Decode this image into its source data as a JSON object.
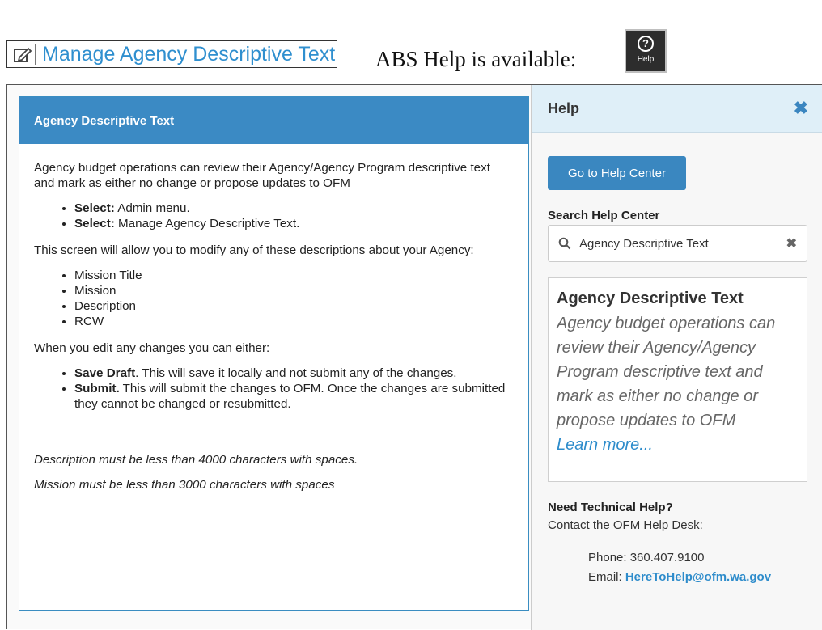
{
  "caption": {
    "link_label": "Manage Agency Descriptive Text",
    "abs_text": "ABS Help is available:",
    "help_badge_label": "Help",
    "icons": {
      "link": "edit-icon",
      "badge": "question-circle-icon"
    }
  },
  "info": {
    "title": "Agency Descriptive Text",
    "intro": "Agency budget operations can review their Agency/Agency Program descriptive text and mark as either no change or propose updates to OFM",
    "select_items": [
      {
        "bold": "Select:",
        "text": " Admin menu."
      },
      {
        "bold": "Select:",
        "text": " Manage Agency Descriptive Text."
      }
    ],
    "modify_text": "This screen will allow you to modify any of these descriptions about your Agency:",
    "descriptions": [
      "Mission Title",
      "Mission",
      "Description",
      "RCW"
    ],
    "edit_text": "When you edit any changes you can either:",
    "options": [
      {
        "bold": "Save Draft",
        "text": ". This will save it locally and not submit any of the changes."
      },
      {
        "bold": "Submit.",
        "text": " This will submit the changes to OFM. Once the changes are submitted they cannot be changed or resubmitted."
      }
    ],
    "note_description": "Description must be less than 4000 characters with spaces.",
    "note_mission": "Mission must be less than 3000 characters with spaces"
  },
  "help": {
    "title": "Help",
    "close_icon": "close-icon",
    "help_center_button": "Go to Help Center",
    "search_label": "Search Help Center",
    "search_value": "Agency Descriptive Text",
    "search_icon": "search-icon",
    "clear_icon": "clear-icon",
    "result": {
      "title": "Agency Descriptive Text",
      "description": "Agency budget operations can review their Agency/Agency Program descriptive text and mark as either no change or propose updates to OFM",
      "link": "Learn more..."
    },
    "tech_heading": "Need Technical Help?",
    "tech_contact": "Contact the OFM Help Desk:",
    "phone_label": "Phone: ",
    "phone": "360.407.9100",
    "email_label": "Email: ",
    "email": "HereToHelp@ofm.wa.gov"
  },
  "colors": {
    "accent": "#3b8ac4",
    "link": "#2e8ccb",
    "header_bg": "#dfeff8"
  }
}
